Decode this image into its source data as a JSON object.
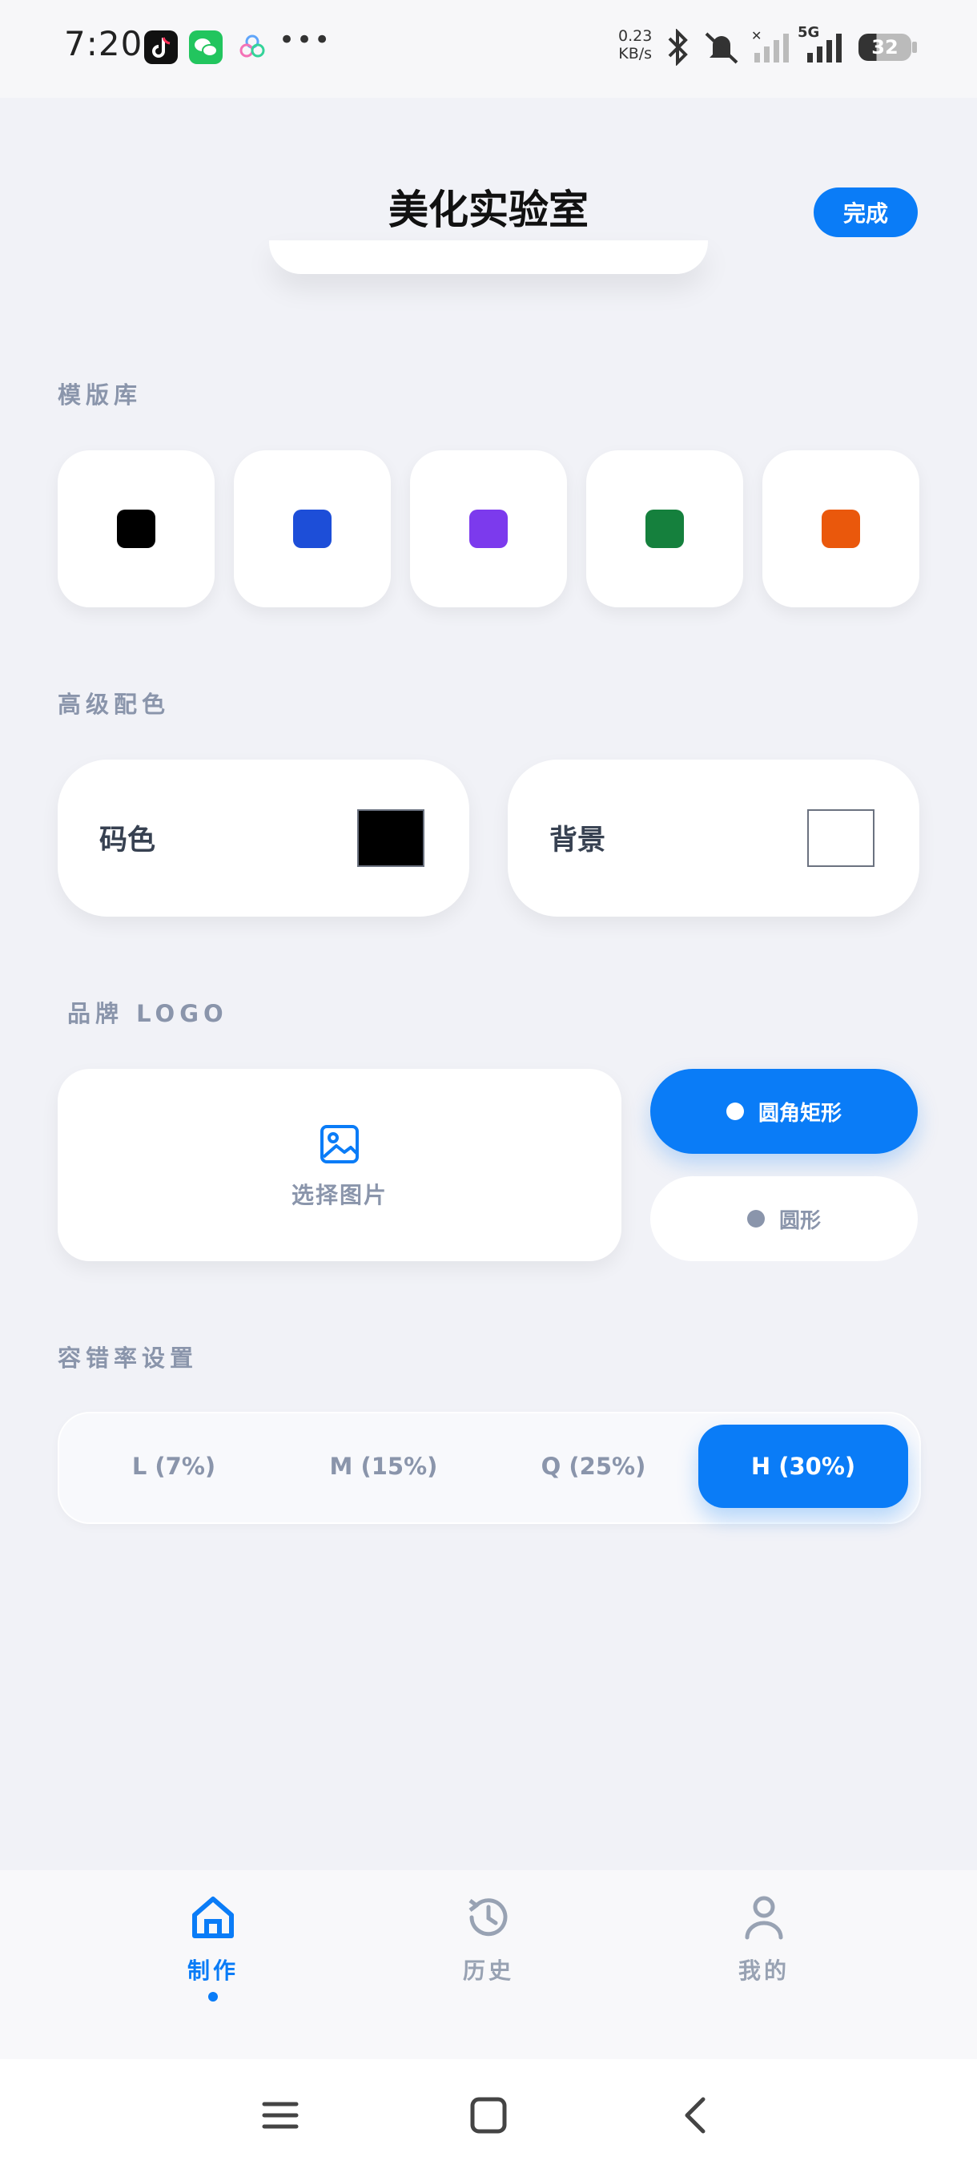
{
  "status_bar": {
    "time": "7:20",
    "net_speed_value": "0.23",
    "net_speed_unit": "KB/s",
    "battery": "32",
    "network": "5G",
    "icons": [
      "tiktok-icon",
      "wechat-icon",
      "gallery-icon",
      "more-dots-icon",
      "bluetooth-icon",
      "mute-icon",
      "signal-icon",
      "signal-5g-icon",
      "battery-icon"
    ]
  },
  "header": {
    "title": "美化实验室",
    "done_label": "完成"
  },
  "templates": {
    "label": "模版库",
    "items": [
      {
        "color": "#000000"
      },
      {
        "color": "#1d4ed8"
      },
      {
        "color": "#7c3aed"
      },
      {
        "color": "#15803d"
      },
      {
        "color": "#ea580c"
      }
    ]
  },
  "colors": {
    "label": "高级配色",
    "code_color_label": "码色",
    "code_color": "#000000",
    "background_label": "背景",
    "background_color": "#ffffff"
  },
  "logo": {
    "label": "品牌 LOGO",
    "select_image_label": "选择图片",
    "shapes": [
      {
        "label": "圆角矩形",
        "selected": true
      },
      {
        "label": "圆形",
        "selected": false
      }
    ]
  },
  "error_correction": {
    "label": "容错率设置",
    "options": [
      {
        "label": "L (7%)",
        "selected": false
      },
      {
        "label": "M (15%)",
        "selected": false
      },
      {
        "label": "Q (25%)",
        "selected": false
      },
      {
        "label": "H (30%)",
        "selected": true
      }
    ]
  },
  "bottom_nav": {
    "items": [
      {
        "label": "制作",
        "icon": "home-icon",
        "active": true
      },
      {
        "label": "历史",
        "icon": "history-icon",
        "active": false
      },
      {
        "label": "我的",
        "icon": "user-icon",
        "active": false
      }
    ]
  },
  "colors_theme": {
    "accent": "#0a7cf7",
    "muted": "#8a95ab",
    "background": "#f1f2f7"
  }
}
